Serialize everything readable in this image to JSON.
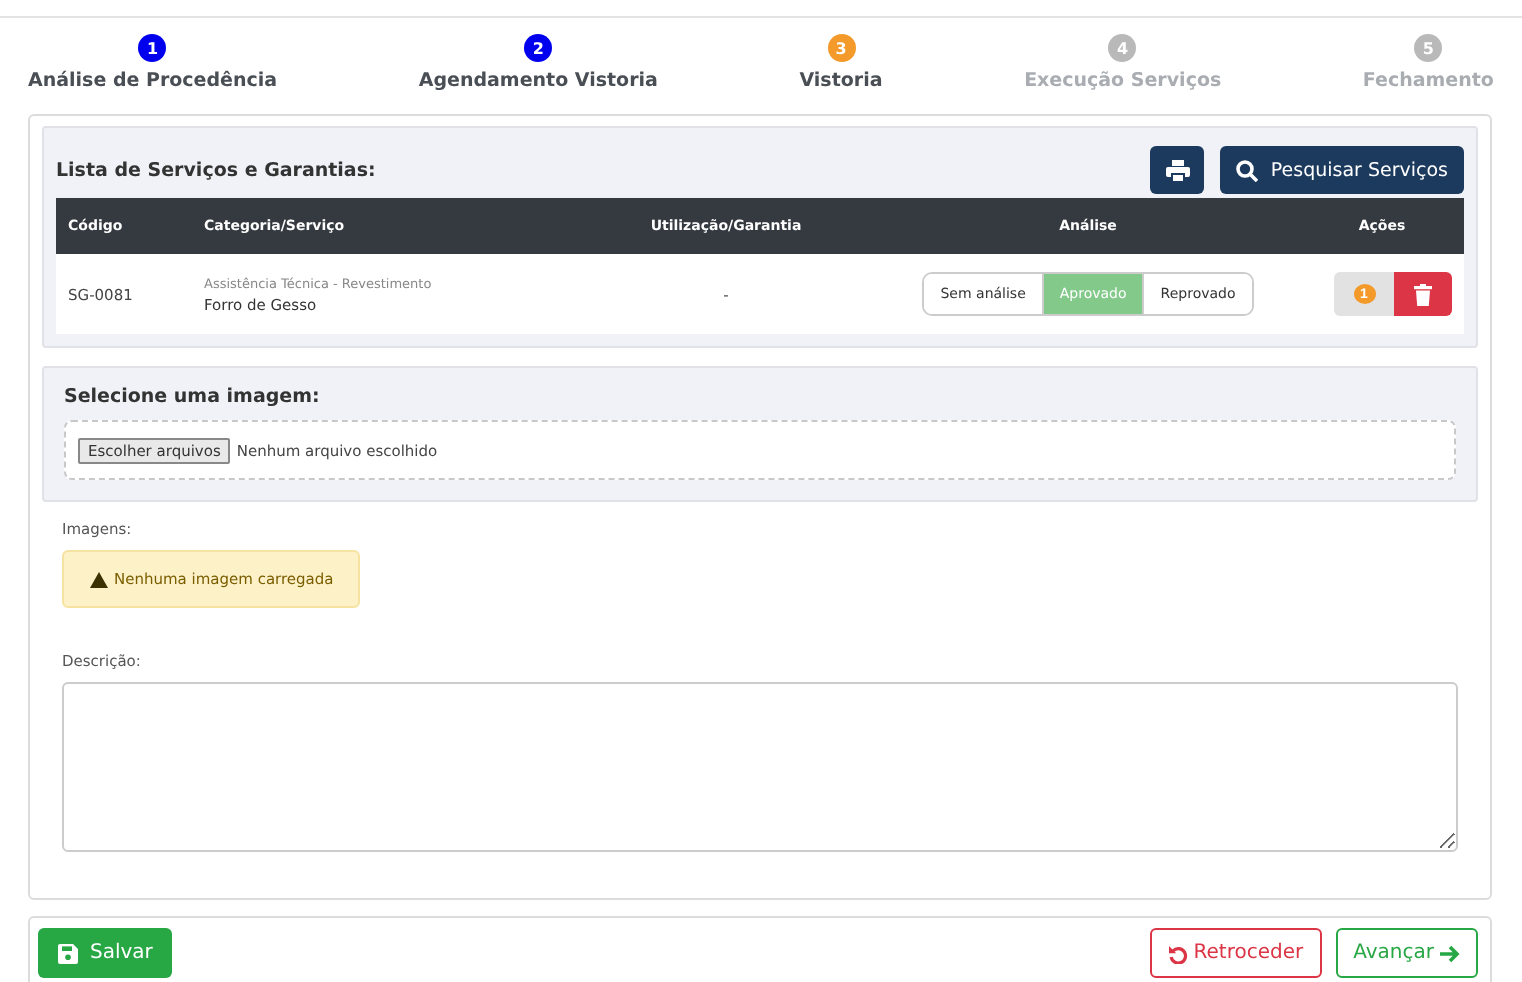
{
  "steps": [
    {
      "number": "1",
      "label": "Análise de Procedência",
      "color": "#0000ee",
      "disabled": false
    },
    {
      "number": "2",
      "label": "Agendamento Vistoria",
      "color": "#0000ee",
      "disabled": false
    },
    {
      "number": "3",
      "label": "Vistoria",
      "color": "#f39a2b",
      "disabled": false
    },
    {
      "number": "4",
      "label": "Execução Serviços",
      "color": "#b9b9b9",
      "disabled": true
    },
    {
      "number": "5",
      "label": "Fechamento",
      "color": "#b9b9b9",
      "disabled": true
    }
  ],
  "services": {
    "title": "Lista de Serviços e Garantias:",
    "search_button": "Pesquisar Serviços",
    "columns": [
      "Código",
      "Categoria/Serviço",
      "Utilização/Garantia",
      "Análise",
      "Ações"
    ],
    "rows": [
      {
        "code": "SG-0081",
        "category": "Assistência Técnica - Revestimento",
        "service": "Forro de Gesso",
        "usage": "-",
        "analysis": [
          {
            "label": "Sem análise",
            "selected": false
          },
          {
            "label": "Aprovado",
            "selected": true
          },
          {
            "label": "Reprovado",
            "selected": false
          }
        ],
        "comment_badge": "1"
      }
    ]
  },
  "image_upload": {
    "label": "Selecione uma imagem:",
    "button": "Escolher arquivos",
    "status": "Nenhum arquivo escolhido"
  },
  "images": {
    "label": "Imagens:",
    "alert": "Nenhuma imagem carregada"
  },
  "description": {
    "label": "Descrição:"
  },
  "footer": {
    "save": "Salvar",
    "back": "Retroceder",
    "next": "Avançar"
  }
}
